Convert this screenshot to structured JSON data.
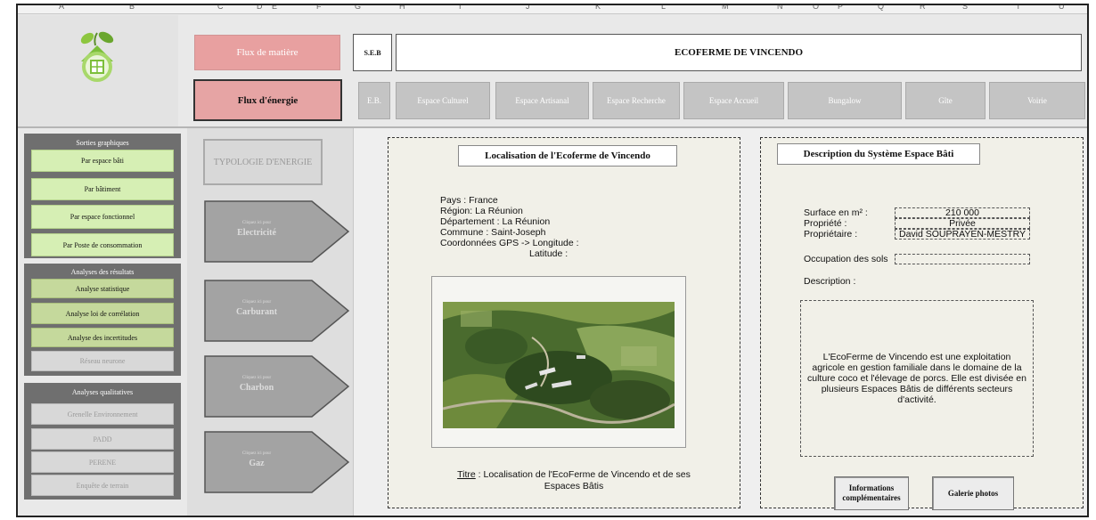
{
  "columns": [
    "A",
    "B",
    "C",
    "D",
    "E",
    "F",
    "G",
    "H",
    "I",
    "J",
    "K",
    "L",
    "M",
    "N",
    "O",
    "P",
    "Q",
    "R",
    "S",
    "T",
    "U"
  ],
  "header": {
    "flux_matiere": "Flux de matière",
    "flux_energie": "Flux d'énergie",
    "seb": "S.E.B",
    "title": "ECOFERME DE VINCENDO"
  },
  "tabs": [
    "E.B.",
    "Espace Culturel",
    "Espace Artisanal",
    "Espace Recherche",
    "Espace Accueil",
    "Bungalow",
    "Gîte",
    "Voirie"
  ],
  "sidebar": {
    "sorties": {
      "title": "Sorties graphiques",
      "items": [
        "Par espace bâti",
        "Par bâtiment",
        "Par espace fonctionnel",
        "Par Poste de consommation"
      ]
    },
    "analyses": {
      "title": "Analyses des résultats",
      "items": [
        "Analyse statistique",
        "Analyse loi de corrélation",
        "Analyse des incertitudes",
        "Réseau neurone"
      ]
    },
    "qualitatives": {
      "title": "Analyses qualitatives",
      "items": [
        "Grenelle Environnement",
        "PADD",
        "PERENE",
        "Enquête de terrain"
      ]
    }
  },
  "energy": {
    "typology": "TYPOLOGIE D'ENERGIE",
    "hint": "Cliquez ici pour",
    "items": [
      "Electricité",
      "Carburant",
      "Charbon",
      "Gaz"
    ]
  },
  "location": {
    "title": "Localisation de l'Ecoferme  de Vincendo",
    "lines": [
      "Pays : France",
      "Région: La Réunion",
      "Département : La Réunion",
      "Commune : Saint-Joseph",
      "Coordonnées GPS -> Longitude :"
    ],
    "latitude": "Latitude :",
    "caption_label": "Titre",
    "caption_text": " : Localisation de l'EcoFerme de Vincendo et de ses Espaces Bâtis"
  },
  "description": {
    "title": "Description du Système  Espace Bâti",
    "surface_label": "Surface en m² :",
    "surface_value": "210 000",
    "propriete_label": "Propriété :",
    "propriete_value": "Privée",
    "proprietaire_label": "Propriétaire :",
    "proprietaire_value": "David SOUPRAYEN-MESTRY",
    "occupation_label": "Occupation des sols",
    "occupation_value": "",
    "description_label": "Description :",
    "text": "L'EcoFerme de Vincendo est une exploitation agricole en gestion familiale dans le domaine de la culture coco et l'élevage de porcs. Elle est divisée en plusieurs Espaces Bâtis de différents secteurs d'activité.",
    "btn_info": "Informations complémentaires",
    "btn_gallery": "Galerie photos"
  }
}
